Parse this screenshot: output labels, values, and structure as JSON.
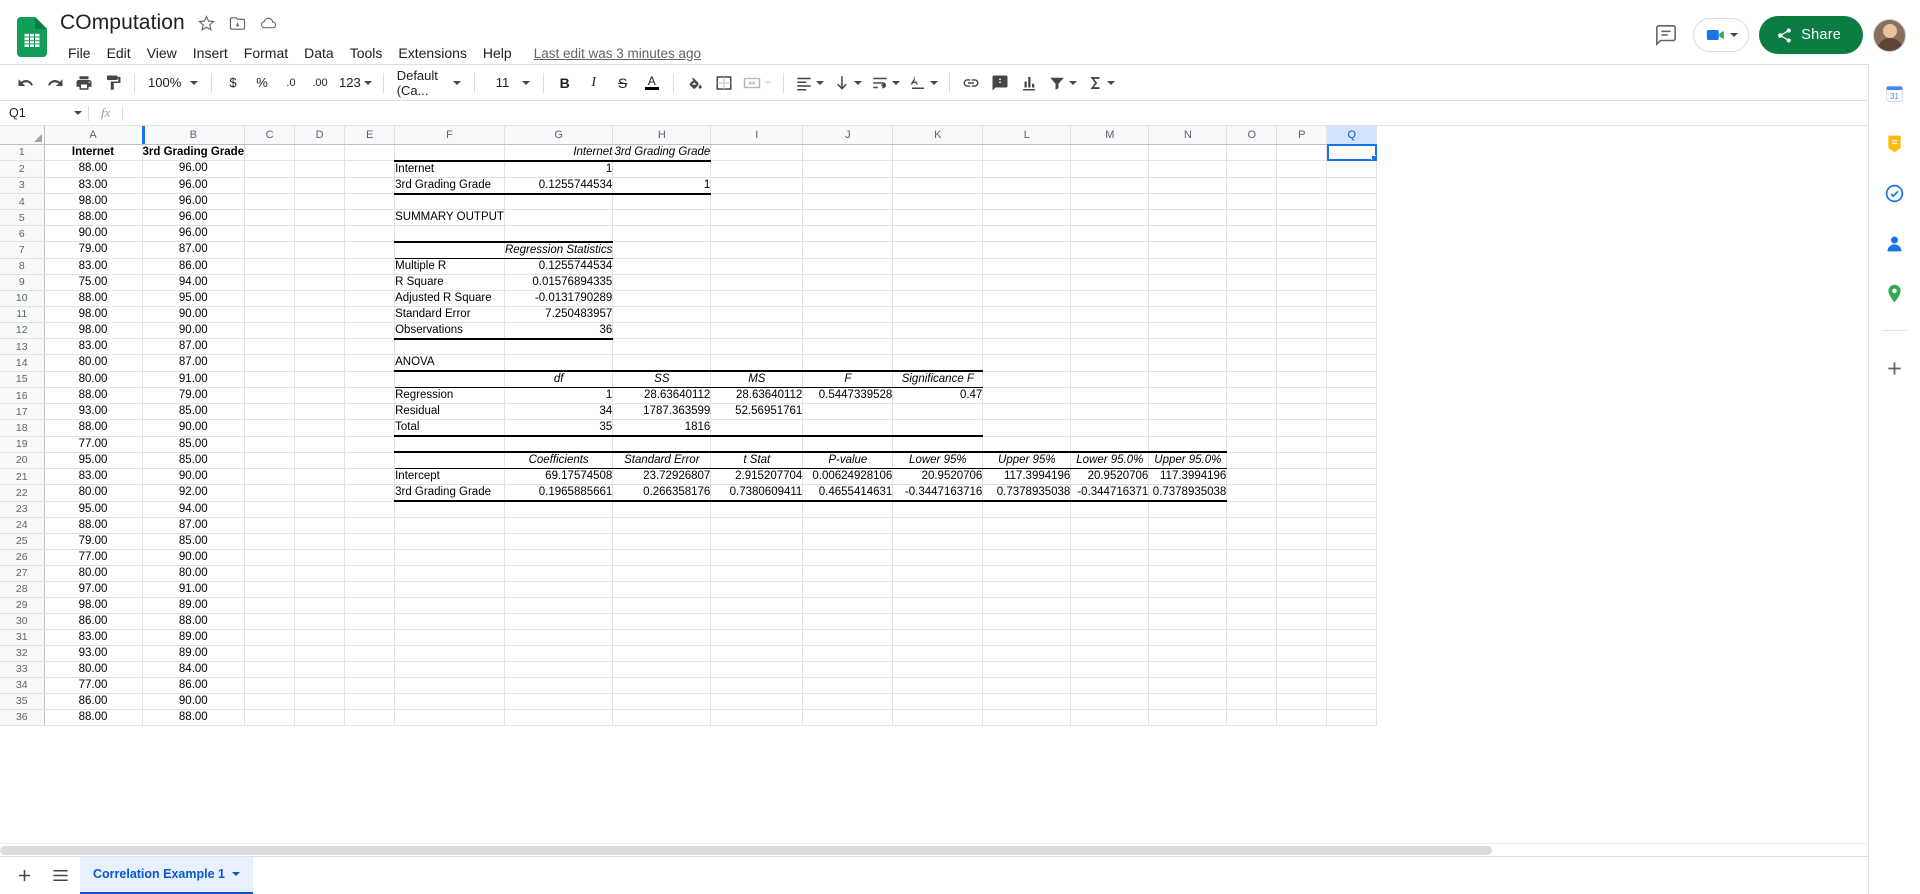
{
  "app": {
    "logo_icon": "sheets-logo-icon",
    "doc_title": "COmputation",
    "title_icons": [
      "star-icon",
      "move-to-folder-icon",
      "cloud-saved-icon"
    ],
    "menus": [
      "File",
      "Edit",
      "View",
      "Insert",
      "Format",
      "Data",
      "Tools",
      "Extensions",
      "Help"
    ],
    "last_edit": "Last edit was 3 minutes ago",
    "share_label": "Share",
    "top_right_icons": [
      "comment-history-icon",
      "meet-camera-icon",
      "avatar"
    ]
  },
  "toolbar": {
    "undo": "undo-icon",
    "redo": "redo-icon",
    "print": "print-icon",
    "paint_format": "paint-format-icon",
    "zoom_value": "100%",
    "currency": "$",
    "percent": "%",
    "decrease_decimal": ".0",
    "increase_decimal": ".00",
    "more_formats": "123",
    "font_family": "Default (Ca...",
    "font_size": "11",
    "bold": "B",
    "italic": "I",
    "strikethrough": "S",
    "text_color": "A",
    "fill_color": "fill-color-icon",
    "borders": "borders-icon",
    "merge_cells": "merge-cells-icon",
    "horizontal_align": "horizontal-align-icon",
    "vertical_align": "vertical-align-icon",
    "text_wrap": "text-wrap-icon",
    "text_rotation": "text-rotation-icon",
    "insert_link": "insert-link-icon",
    "insert_comment": "insert-comment-icon",
    "insert_chart": "insert-chart-icon",
    "create_filter": "filter-icon",
    "functions": "sigma-icon",
    "collapse": "collapse-toolbar-icon"
  },
  "formula_bar": {
    "name_box": "Q1",
    "fx_label": "fx",
    "formula_value": ""
  },
  "grid": {
    "columns": [
      "A",
      "B",
      "C",
      "D",
      "E",
      "F",
      "G",
      "H",
      "I",
      "J",
      "K",
      "L",
      "M",
      "N",
      "O",
      "P",
      "Q"
    ],
    "selected_cell": "Q1",
    "row_count": 36,
    "rows": [
      {
        "n": 1,
        "A": "Internet",
        "B": "3rd Grading Grade"
      },
      {
        "n": 2,
        "A": "88.00",
        "B": "96.00"
      },
      {
        "n": 3,
        "A": "83.00",
        "B": "96.00"
      },
      {
        "n": 4,
        "A": "98.00",
        "B": "96.00"
      },
      {
        "n": 5,
        "A": "88.00",
        "B": "96.00"
      },
      {
        "n": 6,
        "A": "90.00",
        "B": "96.00"
      },
      {
        "n": 7,
        "A": "79.00",
        "B": "87.00"
      },
      {
        "n": 8,
        "A": "83.00",
        "B": "86.00"
      },
      {
        "n": 9,
        "A": "75.00",
        "B": "94.00"
      },
      {
        "n": 10,
        "A": "88.00",
        "B": "95.00"
      },
      {
        "n": 11,
        "A": "98.00",
        "B": "90.00"
      },
      {
        "n": 12,
        "A": "98.00",
        "B": "90.00"
      },
      {
        "n": 13,
        "A": "83.00",
        "B": "87.00"
      },
      {
        "n": 14,
        "A": "80.00",
        "B": "87.00"
      },
      {
        "n": 15,
        "A": "80.00",
        "B": "91.00"
      },
      {
        "n": 16,
        "A": "88.00",
        "B": "79.00"
      },
      {
        "n": 17,
        "A": "93.00",
        "B": "85.00"
      },
      {
        "n": 18,
        "A": "88.00",
        "B": "90.00"
      },
      {
        "n": 19,
        "A": "77.00",
        "B": "85.00"
      },
      {
        "n": 20,
        "A": "95.00",
        "B": "85.00"
      },
      {
        "n": 21,
        "A": "83.00",
        "B": "90.00"
      },
      {
        "n": 22,
        "A": "80.00",
        "B": "92.00"
      },
      {
        "n": 23,
        "A": "95.00",
        "B": "94.00"
      },
      {
        "n": 24,
        "A": "88.00",
        "B": "87.00"
      },
      {
        "n": 25,
        "A": "79.00",
        "B": "85.00"
      },
      {
        "n": 26,
        "A": "77.00",
        "B": "90.00"
      },
      {
        "n": 27,
        "A": "80.00",
        "B": "80.00"
      },
      {
        "n": 28,
        "A": "97.00",
        "B": "91.00"
      },
      {
        "n": 29,
        "A": "98.00",
        "B": "89.00"
      },
      {
        "n": 30,
        "A": "86.00",
        "B": "88.00"
      },
      {
        "n": 31,
        "A": "83.00",
        "B": "89.00"
      },
      {
        "n": 32,
        "A": "93.00",
        "B": "89.00"
      },
      {
        "n": 33,
        "A": "80.00",
        "B": "84.00"
      },
      {
        "n": 34,
        "A": "77.00",
        "B": "86.00"
      },
      {
        "n": 35,
        "A": "86.00",
        "B": "90.00"
      },
      {
        "n": 36,
        "A": "88.00",
        "B": "88.00"
      }
    ],
    "correlation_matrix": {
      "header_row": 1,
      "col_headers": [
        "Internet",
        "3rd Grading Grade"
      ],
      "rows": [
        {
          "row": 2,
          "label": "Internet",
          "values": [
            "1",
            ""
          ]
        },
        {
          "row": 3,
          "label": "3rd Grading Grade",
          "values": [
            "0.1255744534",
            "1"
          ]
        }
      ]
    },
    "summary_output_label": "SUMMARY OUTPUT",
    "summary_output_row": 5,
    "regression_statistics": {
      "title": "Regression Statistics",
      "title_row": 7,
      "rows": [
        {
          "row": 8,
          "label": "Multiple R",
          "value": "0.1255744534"
        },
        {
          "row": 9,
          "label": "R Square",
          "value": "0.01576894335"
        },
        {
          "row": 10,
          "label": "Adjusted R Square",
          "value": "-0.0131790289"
        },
        {
          "row": 11,
          "label": "Standard Error",
          "value": "7.250483957"
        },
        {
          "row": 12,
          "label": "Observations",
          "value": "36"
        }
      ]
    },
    "anova": {
      "label": "ANOVA",
      "label_row": 14,
      "header_row": 15,
      "headers": [
        "df",
        "SS",
        "MS",
        "F",
        "Significance F"
      ],
      "rows": [
        {
          "row": 16,
          "label": "Regression",
          "df": "1",
          "ss": "28.63640112",
          "ms": "28.63640112",
          "f": "0.5447339528",
          "sig_f": "0.47"
        },
        {
          "row": 17,
          "label": "Residual",
          "df": "34",
          "ss": "1787.363599",
          "ms": "52.56951761",
          "f": "",
          "sig_f": ""
        },
        {
          "row": 18,
          "label": "Total",
          "df": "35",
          "ss": "1816",
          "ms": "",
          "f": "",
          "sig_f": ""
        }
      ]
    },
    "coefficients_table": {
      "header_row": 20,
      "headers": [
        "Coefficients",
        "Standard Error",
        "t Stat",
        "P-value",
        "Lower 95%",
        "Upper 95%",
        "Lower 95.0%",
        "Upper 95.0%"
      ],
      "rows": [
        {
          "row": 21,
          "label": "Intercept",
          "values": [
            "69.17574508",
            "23.72926807",
            "2.915207704",
            "0.00624928106",
            "20.9520706",
            "117.3994196",
            "20.9520706",
            "117.3994196"
          ]
        },
        {
          "row": 22,
          "label": "3rd Grading Grade",
          "values": [
            "0.1965885661",
            "0.266358176",
            "0.7380609411",
            "0.4655414631",
            "-0.3447163716",
            "0.7378935038",
            "-0.344716371",
            "0.7378935038"
          ]
        }
      ]
    }
  },
  "sidepanel": {
    "items": [
      {
        "name": "calendar-icon",
        "label": "Calendar"
      },
      {
        "name": "keep-icon",
        "label": "Keep"
      },
      {
        "name": "tasks-icon",
        "label": "Tasks"
      },
      {
        "name": "contacts-icon",
        "label": "Contacts"
      },
      {
        "name": "maps-icon",
        "label": "Maps"
      },
      {
        "name": "add-ons-icon",
        "label": "Get Add-ons"
      }
    ]
  },
  "sheetbar": {
    "add_sheet": "add-sheet-icon",
    "all_sheets": "all-sheets-icon",
    "tabs": [
      {
        "label": "Correlation Example 1",
        "active": true
      }
    ],
    "explore": "explore-icon"
  }
}
